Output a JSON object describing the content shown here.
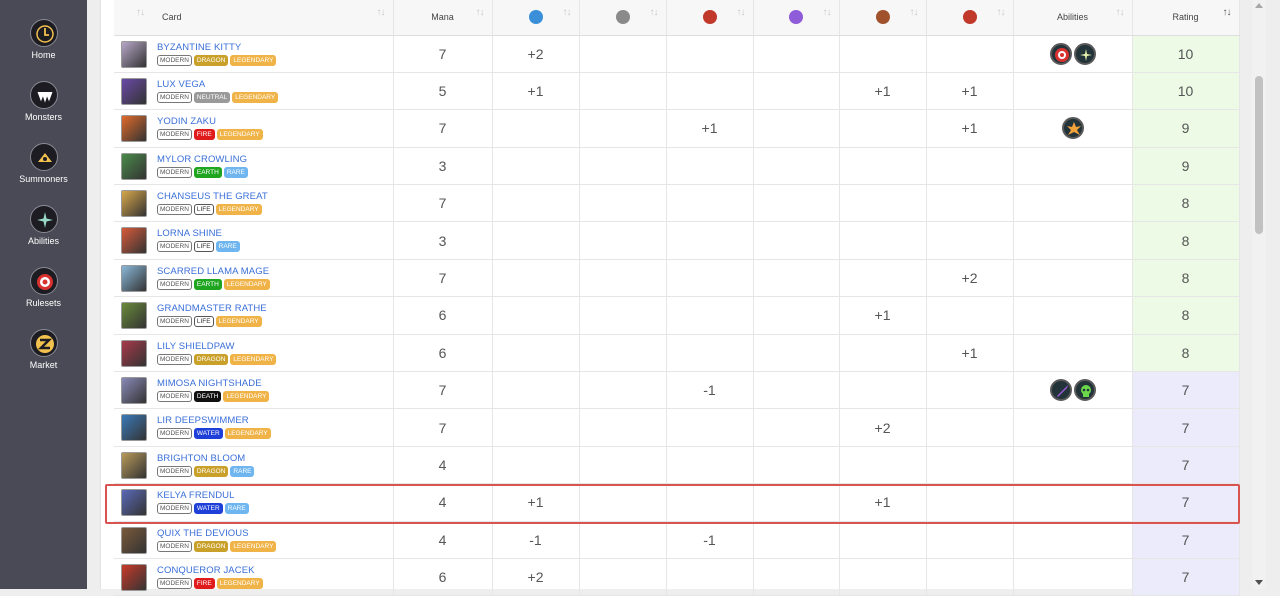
{
  "sidebar": {
    "items": [
      {
        "label": "Home",
        "icon": "home-icon"
      },
      {
        "label": "Monsters",
        "icon": "monsters-icon"
      },
      {
        "label": "Summoners",
        "icon": "summoners-icon"
      },
      {
        "label": "Abilities",
        "icon": "abilities-icon"
      },
      {
        "label": "Rulesets",
        "icon": "rulesets-icon"
      },
      {
        "label": "Market",
        "icon": "market-icon"
      }
    ]
  },
  "table": {
    "headers": {
      "card": "Card",
      "mana": "Mana",
      "abilities": "Abilities",
      "rating": "Rating"
    },
    "stat_icons": [
      "speed-icon",
      "armor-icon",
      "ranged-icon",
      "magic-icon",
      "melee-icon",
      "health-icon"
    ],
    "stat_colors": [
      "#3a8fd8",
      "#8a8a8a",
      "#c0392b",
      "#8e5bd9",
      "#a0522d",
      "#c0392b"
    ],
    "rows": [
      {
        "name": "BYZANTINE KITTY",
        "tags": [
          "MODERN",
          "DRAGON",
          "LEGENDARY"
        ],
        "mana": "7",
        "stats": [
          "+2",
          "",
          "",
          "",
          "",
          ""
        ],
        "abilities": [
          "ability-target-icon",
          "ability-sparkle-icon"
        ],
        "rating": "10",
        "tier": "high"
      },
      {
        "name": "LUX VEGA",
        "tags": [
          "MODERN",
          "NEUTRAL",
          "LEGENDARY"
        ],
        "mana": "5",
        "stats": [
          "+1",
          "",
          "",
          "",
          "+1",
          "+1"
        ],
        "abilities": [],
        "rating": "10",
        "tier": "high"
      },
      {
        "name": "YODIN ZAKU",
        "tags": [
          "MODERN",
          "FIRE",
          "LEGENDARY"
        ],
        "mana": "7",
        "stats": [
          "",
          "",
          "+1",
          "",
          "",
          "+1"
        ],
        "abilities": [
          "ability-burst-icon"
        ],
        "rating": "9",
        "tier": "high"
      },
      {
        "name": "MYLOR CROWLING",
        "tags": [
          "MODERN",
          "EARTH",
          "RARE"
        ],
        "mana": "3",
        "stats": [
          "",
          "",
          "",
          "",
          "",
          ""
        ],
        "abilities": [],
        "rating": "9",
        "tier": "high"
      },
      {
        "name": "CHANSEUS THE GREAT",
        "tags": [
          "MODERN",
          "LIFE",
          "LEGENDARY"
        ],
        "mana": "7",
        "stats": [
          "",
          "",
          "",
          "",
          "",
          ""
        ],
        "abilities": [],
        "rating": "8",
        "tier": "high"
      },
      {
        "name": "LORNA SHINE",
        "tags": [
          "MODERN",
          "LIFE",
          "RARE"
        ],
        "mana": "3",
        "stats": [
          "",
          "",
          "",
          "",
          "",
          ""
        ],
        "abilities": [],
        "rating": "8",
        "tier": "high"
      },
      {
        "name": "SCARRED LLAMA MAGE",
        "tags": [
          "MODERN",
          "EARTH",
          "LEGENDARY"
        ],
        "mana": "7",
        "stats": [
          "",
          "",
          "",
          "",
          "",
          "+2"
        ],
        "abilities": [],
        "rating": "8",
        "tier": "high"
      },
      {
        "name": "GRANDMASTER RATHE",
        "tags": [
          "MODERN",
          "LIFE",
          "LEGENDARY"
        ],
        "mana": "6",
        "stats": [
          "",
          "",
          "",
          "",
          "+1",
          ""
        ],
        "abilities": [],
        "rating": "8",
        "tier": "high"
      },
      {
        "name": "LILY SHIELDPAW",
        "tags": [
          "MODERN",
          "DRAGON",
          "LEGENDARY"
        ],
        "mana": "6",
        "stats": [
          "",
          "",
          "",
          "",
          "",
          "+1"
        ],
        "abilities": [],
        "rating": "8",
        "tier": "high"
      },
      {
        "name": "MIMOSA NIGHTSHADE",
        "tags": [
          "MODERN",
          "DEATH",
          "LEGENDARY"
        ],
        "mana": "7",
        "stats": [
          "",
          "",
          "-1",
          "",
          "",
          ""
        ],
        "abilities": [
          "ability-dagger-icon",
          "ability-skull-icon"
        ],
        "rating": "7",
        "tier": "mid"
      },
      {
        "name": "LIR DEEPSWIMMER",
        "tags": [
          "MODERN",
          "WATER",
          "LEGENDARY"
        ],
        "mana": "7",
        "stats": [
          "",
          "",
          "",
          "",
          "+2",
          ""
        ],
        "abilities": [],
        "rating": "7",
        "tier": "mid"
      },
      {
        "name": "BRIGHTON BLOOM",
        "tags": [
          "MODERN",
          "DRAGON",
          "RARE"
        ],
        "mana": "4",
        "stats": [
          "",
          "",
          "",
          "",
          "",
          ""
        ],
        "abilities": [],
        "rating": "7",
        "tier": "mid"
      },
      {
        "name": "KELYA FRENDUL",
        "tags": [
          "MODERN",
          "WATER",
          "RARE"
        ],
        "mana": "4",
        "stats": [
          "+1",
          "",
          "",
          "",
          "+1",
          ""
        ],
        "abilities": [],
        "rating": "7",
        "tier": "mid"
      },
      {
        "name": "QUIX THE DEVIOUS",
        "tags": [
          "MODERN",
          "DRAGON",
          "LEGENDARY"
        ],
        "mana": "4",
        "stats": [
          "-1",
          "",
          "-1",
          "",
          "",
          ""
        ],
        "abilities": [],
        "rating": "7",
        "tier": "mid"
      },
      {
        "name": "CONQUEROR JACEK",
        "tags": [
          "MODERN",
          "FIRE",
          "LEGENDARY"
        ],
        "mana": "6",
        "stats": [
          "+2",
          "",
          "",
          "",
          "",
          ""
        ],
        "abilities": [],
        "rating": "7",
        "tier": "mid"
      }
    ]
  },
  "tag_colors": {
    "DRAGON": "#c9a12a",
    "NEUTRAL": "#9a9a9a",
    "FIRE": "#e01b1b",
    "EARTH": "#1fa51f",
    "LIFE": "#ffffff",
    "DEATH": "#111111",
    "WATER": "#1e3fd8",
    "LEGENDARY": "#f0b347",
    "RARE": "#6fb6f0"
  },
  "accent": "#3a6fd8",
  "highlight_color": "#d9534f"
}
